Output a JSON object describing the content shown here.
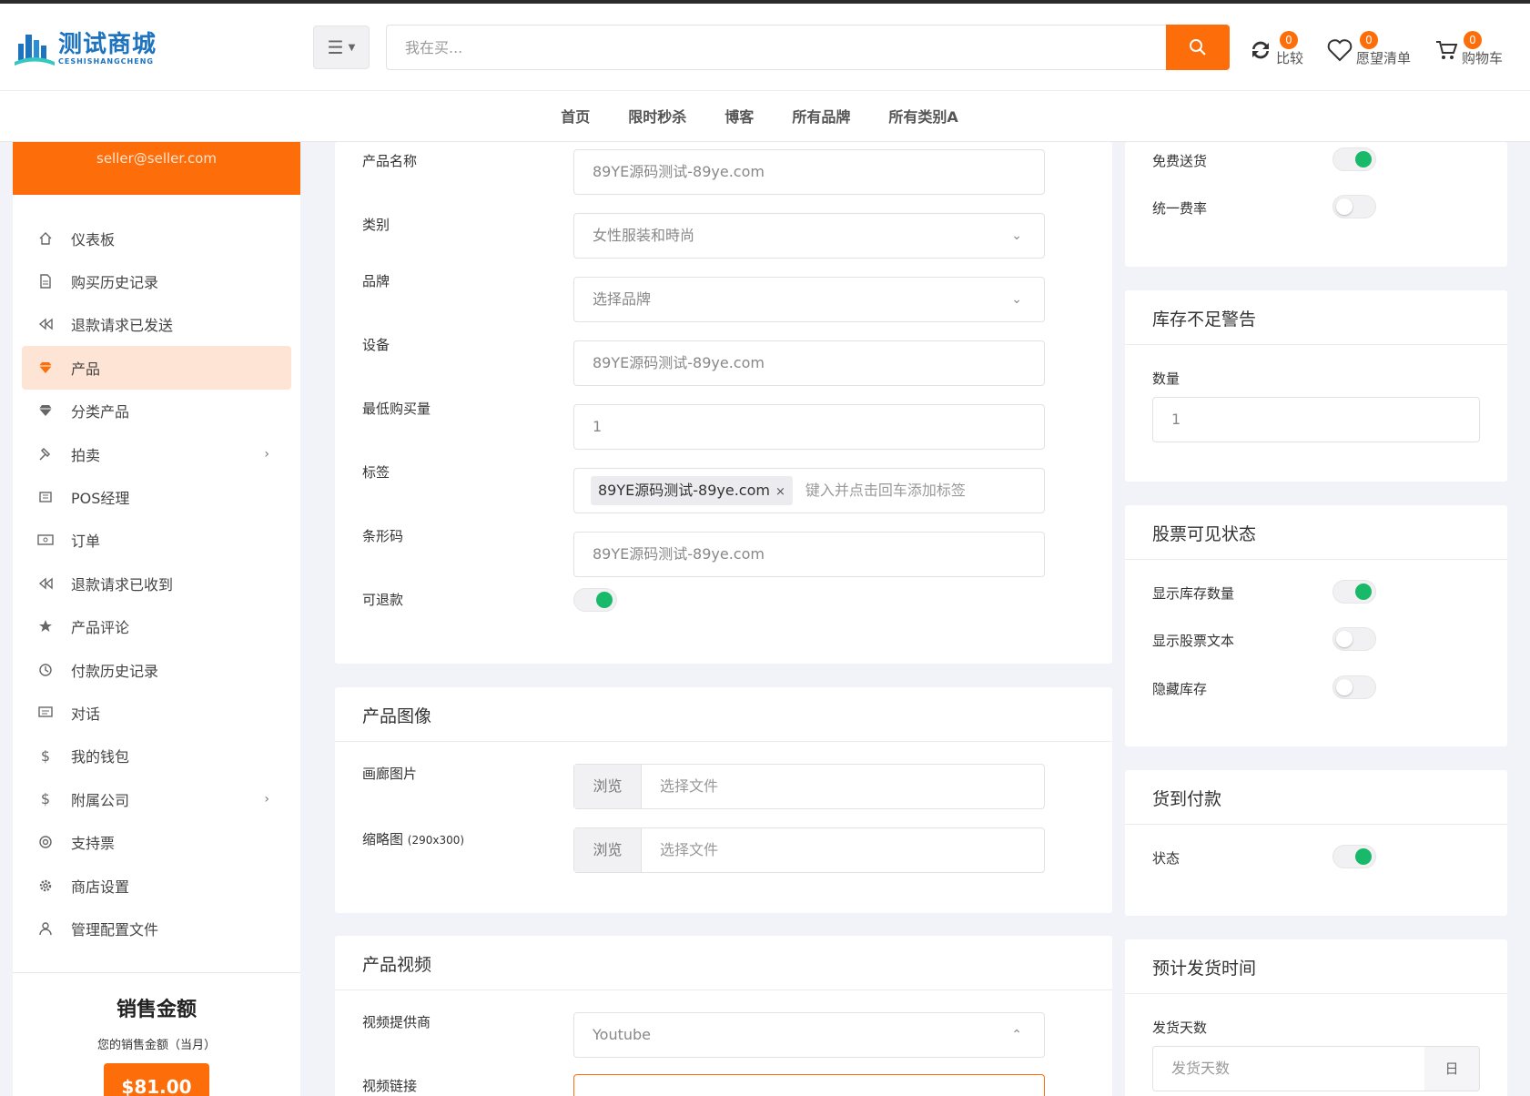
{
  "colors": {
    "accent": "#fd6e0a",
    "toggle_on": "#19b96a",
    "brand": "#1e73be"
  },
  "header": {
    "logo_title": "测试商城",
    "logo_sub": "CESHISHANGCHENG",
    "search_placeholder": "我在买...",
    "compare": {
      "count": "0",
      "label": "比较"
    },
    "wishlist": {
      "count": "0",
      "label": "愿望清单"
    },
    "cart": {
      "count": "0",
      "label": "购物车"
    }
  },
  "nav": [
    "首页",
    "限时秒杀",
    "博客",
    "所有品牌",
    "所有类别A"
  ],
  "sidebar": {
    "email": "seller@seller.com",
    "items": [
      {
        "label": "仪表板",
        "icon": "home-icon"
      },
      {
        "label": "购买历史记录",
        "icon": "file-icon"
      },
      {
        "label": "退款请求已发送",
        "icon": "rewind-icon"
      },
      {
        "label": "产品",
        "icon": "diamond-icon",
        "active": true
      },
      {
        "label": "分类产品",
        "icon": "diamond-icon"
      },
      {
        "label": "拍卖",
        "icon": "gavel-icon",
        "has_submenu": true
      },
      {
        "label": "POS经理",
        "icon": "register-icon"
      },
      {
        "label": "订单",
        "icon": "money-icon"
      },
      {
        "label": "退款请求已收到",
        "icon": "rewind-icon"
      },
      {
        "label": "产品评论",
        "icon": "star-icon"
      },
      {
        "label": "付款历史记录",
        "icon": "history-icon"
      },
      {
        "label": "对话",
        "icon": "chat-icon"
      },
      {
        "label": "我的钱包",
        "icon": "dollar-icon"
      },
      {
        "label": "附属公司",
        "icon": "dollar-icon",
        "has_submenu": true
      },
      {
        "label": "支持票",
        "icon": "support-icon"
      },
      {
        "label": "商店设置",
        "icon": "cog-icon"
      },
      {
        "label": "管理配置文件",
        "icon": "user-icon"
      }
    ],
    "sales": {
      "title": "销售金额",
      "subtitle": "您的销售金额（当月）",
      "amount": "$81.00"
    }
  },
  "product_form": {
    "name": {
      "label": "产品名称",
      "placeholder": "89YE源码测试-89ye.com"
    },
    "category": {
      "label": "类别",
      "value": "女性服装和時尚"
    },
    "brand": {
      "label": "品牌",
      "value": "选择品牌"
    },
    "unit": {
      "label": "设备",
      "placeholder": "89YE源码测试-89ye.com"
    },
    "min_qty": {
      "label": "最低购买量",
      "value": "1"
    },
    "tags": {
      "label": "标签",
      "tag": "89YE源码测试-89ye.com",
      "tag_remove": "×",
      "placeholder": "键入并点击回车添加标签"
    },
    "barcode": {
      "label": "条形码",
      "placeholder": "89YE源码测试-89ye.com"
    },
    "refundable": {
      "label": "可退款",
      "on": true
    }
  },
  "product_images": {
    "title": "产品图像",
    "gallery": {
      "label": "画廊图片",
      "browse": "浏览",
      "choose": "选择文件"
    },
    "thumbnail": {
      "label": "缩略图",
      "hint": "(290x300)",
      "browse": "浏览",
      "choose": "选择文件"
    }
  },
  "product_video": {
    "title": "产品视频",
    "provider": {
      "label": "视频提供商",
      "value": "Youtube"
    },
    "link": {
      "label": "视频链接"
    }
  },
  "shipping": {
    "free_shipping": {
      "label": "免费送货",
      "on": true
    },
    "flat_rate": {
      "label": "统一费率",
      "on": false
    }
  },
  "low_stock": {
    "title": "库存不足警告",
    "qty_label": "数量",
    "qty_value": "1"
  },
  "stock_visibility": {
    "title": "股票可见状态",
    "show_qty": {
      "label": "显示库存数量",
      "on": true
    },
    "show_text": {
      "label": "显示股票文本",
      "on": false
    },
    "hide_stock": {
      "label": "隐藏库存",
      "on": false
    }
  },
  "cod": {
    "title": "货到付款",
    "status": {
      "label": "状态",
      "on": true
    }
  },
  "est_shipping": {
    "title": "预计发货时间",
    "days_label": "发货天数",
    "days_placeholder": "发货天数",
    "unit": "日"
  }
}
